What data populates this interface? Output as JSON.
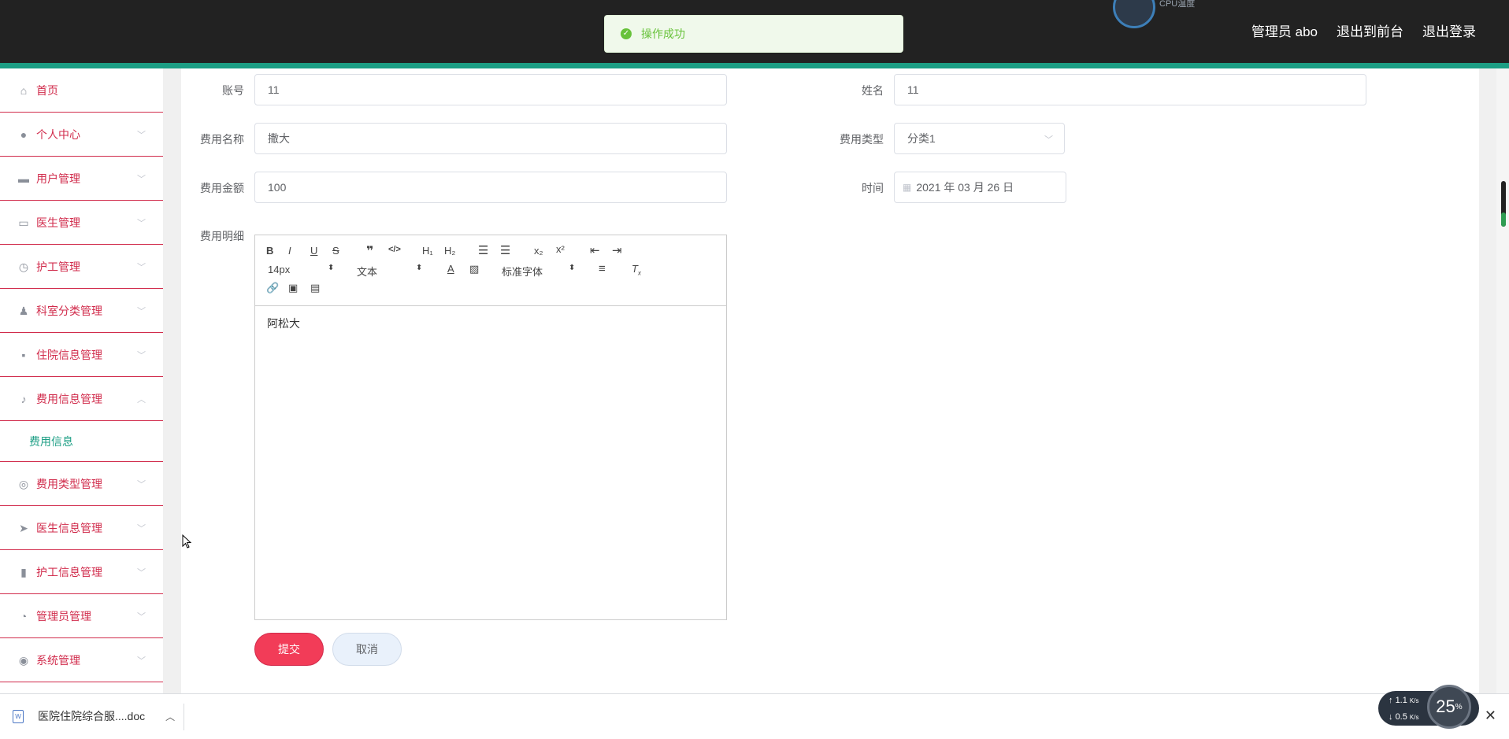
{
  "header": {
    "admin_label": "管理员 abo",
    "front_link": "退出到前台",
    "logout_link": "退出登录",
    "cpu_label": "CPU温度",
    "accent_color": "#1c9e84"
  },
  "toast": {
    "message": "操作成功",
    "type": "success"
  },
  "sidebar": {
    "items": [
      {
        "label": "首页",
        "icon": "home-icon"
      },
      {
        "label": "个人中心",
        "icon": "user-icon"
      },
      {
        "label": "用户管理",
        "icon": "ticket-icon"
      },
      {
        "label": "医生管理",
        "icon": "monitor-icon"
      },
      {
        "label": "护工管理",
        "icon": "gauge-icon"
      },
      {
        "label": "科室分类管理",
        "icon": "person-icon"
      },
      {
        "label": "住院信息管理",
        "icon": "chat-icon"
      },
      {
        "label": "费用信息管理",
        "icon": "mic-icon"
      },
      {
        "label": "费用类型管理",
        "icon": "globe-icon"
      },
      {
        "label": "医生信息管理",
        "icon": "send-icon"
      },
      {
        "label": "护工信息管理",
        "icon": "bar-chart-icon"
      },
      {
        "label": "管理员管理",
        "icon": "clock-icon"
      },
      {
        "label": "系统管理",
        "icon": "target-icon"
      }
    ],
    "sub_item": "费用信息",
    "label_color": "#d12c4c"
  },
  "form": {
    "account_label": "账号",
    "account_value": "11",
    "name_label": "姓名",
    "name_value": "11",
    "fee_name_label": "费用名称",
    "fee_name_value": "撒大",
    "fee_type_label": "费用类型",
    "fee_type_value": "分类1",
    "fee_amount_label": "费用金额",
    "fee_amount_value": "100",
    "time_label": "时间",
    "time_value": "2021 年 03 月 26 日",
    "detail_label": "费用明细",
    "editor": {
      "font_size": "14px",
      "header_select": "文本",
      "font_family": "标准字体",
      "content": "阿松大"
    },
    "submit": "提交",
    "cancel": "取消"
  },
  "download_bar": {
    "file_name": "医院住院综合服....doc",
    "net_up": "1.1",
    "net_down": "0.5",
    "unit": "K/s",
    "percent": "25"
  }
}
